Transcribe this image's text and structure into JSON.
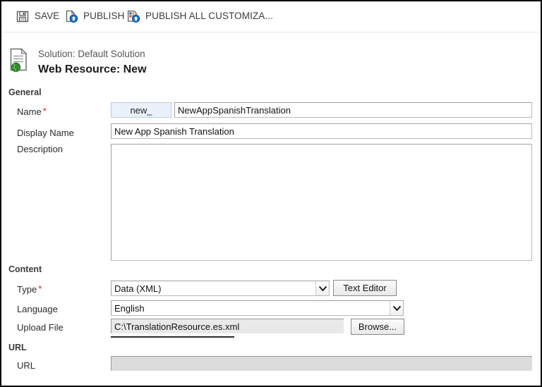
{
  "commandbar": {
    "buttons": [
      {
        "label": "SAVE",
        "icon": "save-icon"
      },
      {
        "label": "PUBLISH",
        "icon": "publish-icon"
      },
      {
        "label": "PUBLISH ALL CUSTOMIZA...",
        "icon": "publish-all-customizations-icon"
      }
    ]
  },
  "header": {
    "icon": "web-resource-globe-icon",
    "solution": "Solution: Default Solution",
    "title": "Web Resource: New"
  },
  "sections": {
    "general": "General",
    "content": "Content",
    "url": "URL"
  },
  "fields": {
    "name": {
      "label": "Name",
      "required": "*",
      "prefix": "new_",
      "value": "NewAppSpanishTranslation",
      "placeholder": ""
    },
    "display_name": {
      "label": "Display Name",
      "value": "New App Spanish Translation",
      "placeholder": ""
    },
    "description": {
      "label": "Description",
      "value": "",
      "placeholder": ""
    },
    "type": {
      "label": "Type",
      "required": "*",
      "value": "Data (XML)",
      "options": [
        "Data (XML)"
      ]
    },
    "language": {
      "label": "Language",
      "value": "English",
      "options": [
        "English"
      ]
    },
    "upload_file": {
      "label": "Upload File",
      "value": "C:\\TranslationResource.es.xml",
      "placeholder": ""
    },
    "url": {
      "label": "URL",
      "value": "",
      "placeholder": ""
    }
  },
  "buttons": {
    "text_editor": "Text Editor",
    "browse": "Browse..."
  },
  "colors": {
    "required_asterisk": "#e81123",
    "prefix_background": "#eaf1fb",
    "disabled_background": "#dcdcdc",
    "accent_blue": "#1a6fc4"
  }
}
